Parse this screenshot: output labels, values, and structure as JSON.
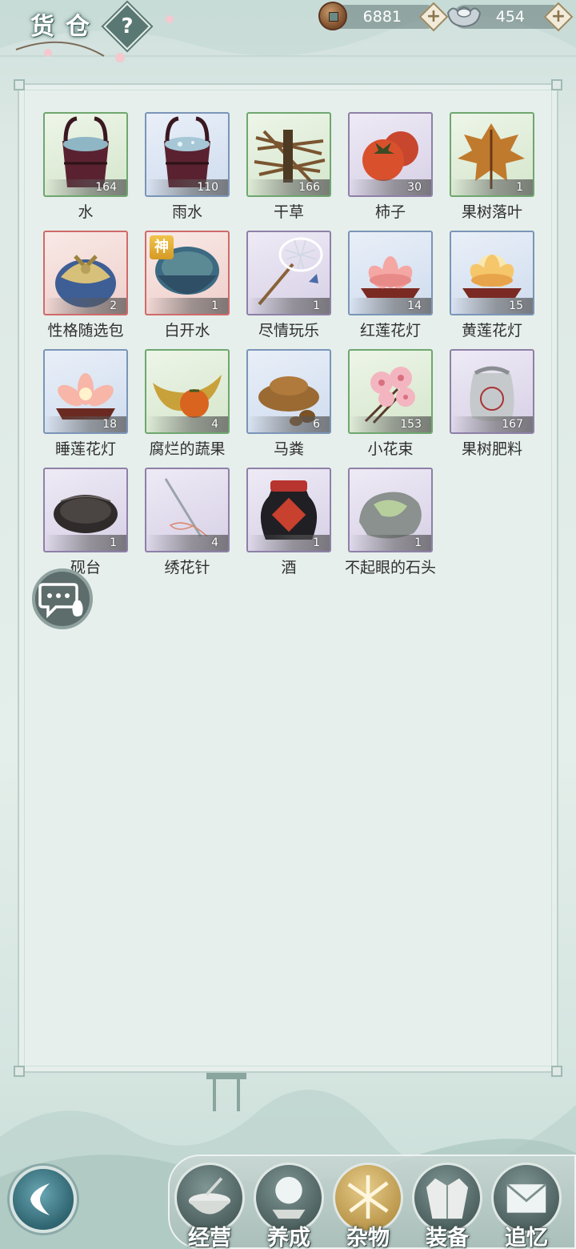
{
  "header": {
    "title": "货仓",
    "help_label": "?",
    "currency": [
      {
        "icon": "copper-coin-icon",
        "value": "6881"
      },
      {
        "icon": "silver-ingot-icon",
        "value": "454"
      }
    ],
    "add_label": "+"
  },
  "items": [
    {
      "name": "水",
      "count": "164",
      "rarity": "green",
      "icon": "water-bucket-icon"
    },
    {
      "name": "雨水",
      "count": "110",
      "rarity": "blue",
      "icon": "rainwater-bucket-icon"
    },
    {
      "name": "干草",
      "count": "166",
      "rarity": "green",
      "icon": "hay-bundle-icon"
    },
    {
      "name": "柿子",
      "count": "30",
      "rarity": "purple",
      "icon": "persimmon-icon"
    },
    {
      "name": "果树落叶",
      "count": "1",
      "rarity": "green",
      "icon": "fallen-leaf-icon"
    },
    {
      "name": "性格随选包",
      "count": "2",
      "rarity": "red",
      "icon": "cloth-bundle-icon"
    },
    {
      "name": "白开水",
      "count": "1",
      "rarity": "red",
      "icon": "water-bowl-icon",
      "badge": "神"
    },
    {
      "name": "尽情玩乐",
      "count": "1",
      "rarity": "purple",
      "icon": "butterfly-net-icon"
    },
    {
      "name": "红莲花灯",
      "count": "14",
      "rarity": "blue",
      "icon": "red-lotus-lamp-icon"
    },
    {
      "name": "黄莲花灯",
      "count": "15",
      "rarity": "blue",
      "icon": "yellow-lotus-lamp-icon"
    },
    {
      "name": "睡莲花灯",
      "count": "18",
      "rarity": "blue",
      "icon": "water-lily-lamp-icon"
    },
    {
      "name": "腐烂的蔬果",
      "count": "4",
      "rarity": "green",
      "icon": "rotten-fruit-icon"
    },
    {
      "name": "马粪",
      "count": "6",
      "rarity": "blue",
      "icon": "horse-dung-icon"
    },
    {
      "name": "小花束",
      "count": "153",
      "rarity": "green",
      "icon": "flower-bouquet-icon"
    },
    {
      "name": "果树肥料",
      "count": "167",
      "rarity": "purple",
      "icon": "fertilizer-sack-icon"
    },
    {
      "name": "砚台",
      "count": "1",
      "rarity": "purple",
      "icon": "inkstone-icon"
    },
    {
      "name": "绣花针",
      "count": "4",
      "rarity": "purple",
      "icon": "embroidery-needle-icon"
    },
    {
      "name": "酒",
      "count": "1",
      "rarity": "purple",
      "icon": "wine-jar-icon"
    },
    {
      "name": "不起眼的石头",
      "count": "1",
      "rarity": "purple",
      "icon": "plain-stone-icon"
    }
  ],
  "chat": {
    "icon": "chat-bubble-icon"
  },
  "nav": {
    "back_icon": "back-arrow-icon",
    "tabs": [
      {
        "label": "经营",
        "icon": "bowl-icon",
        "active": false
      },
      {
        "label": "养成",
        "icon": "crystal-ball-icon",
        "active": false
      },
      {
        "label": "杂物",
        "icon": "hay-icon",
        "active": true
      },
      {
        "label": "装备",
        "icon": "robe-icon",
        "active": false
      },
      {
        "label": "追忆",
        "icon": "letter-icon",
        "active": false
      }
    ]
  },
  "colors": {
    "green": "#6fa76f",
    "blue": "#7b95b8",
    "purple": "#8e80a8",
    "red": "#d06a6a",
    "accent_gold": "#d5a84a"
  }
}
